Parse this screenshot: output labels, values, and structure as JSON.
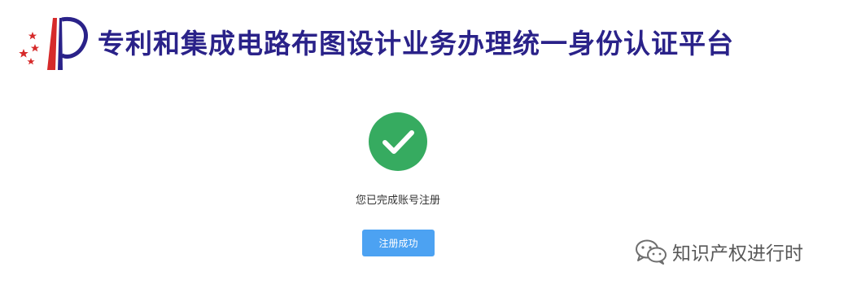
{
  "header": {
    "logo_icon": "cnipa-logo-icon",
    "title": "专利和集成电路布图设计业务办理统一身份认证平台"
  },
  "result": {
    "icon": "checkmark-circle-icon",
    "message": "您已完成账号注册",
    "button_label": "注册成功"
  },
  "watermark": {
    "icon": "wechat-icon",
    "text": "知识产权进行时"
  },
  "colors": {
    "title": "#2a2289",
    "success": "#36ab60",
    "button": "#4ca2f2",
    "logo_red": "#d62a2a"
  }
}
